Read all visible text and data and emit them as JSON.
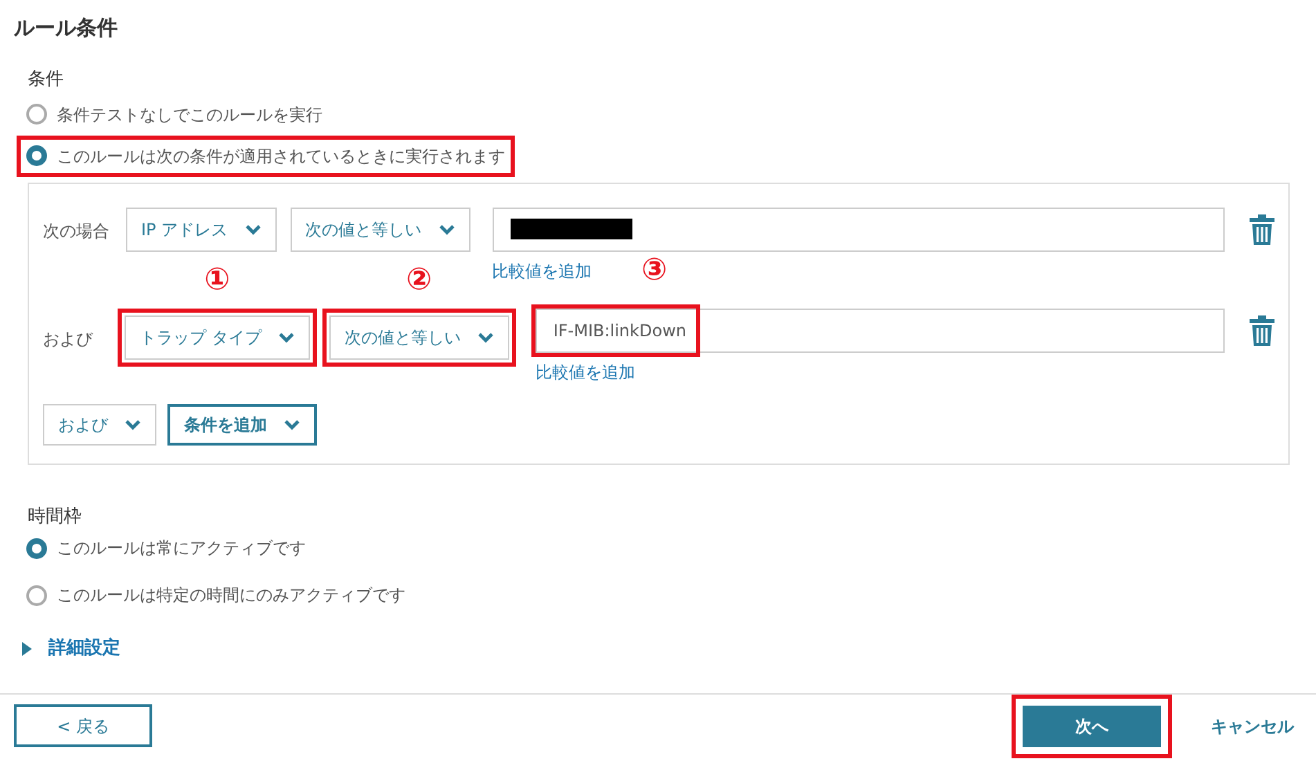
{
  "title": "ルール条件",
  "conditions": {
    "heading": "条件",
    "options": [
      {
        "label": "条件テストなしでこのルールを実行",
        "selected": false,
        "highlighted": false
      },
      {
        "label": "このルールは次の条件が適用されているときに実行されます",
        "selected": true,
        "highlighted": true
      }
    ],
    "rows": [
      {
        "connector": "次の場合",
        "field": {
          "label": "IP アドレス",
          "highlighted": false
        },
        "operator": {
          "label": "次の値と等しい",
          "highlighted": false
        },
        "value": {
          "redacted": true,
          "highlighted": false
        },
        "add_link": "比較値を追加"
      },
      {
        "connector": "および",
        "field": {
          "label": "トラップ タイプ",
          "highlighted": true,
          "callout": "①"
        },
        "operator": {
          "label": "次の値と等しい",
          "highlighted": true,
          "callout": "②"
        },
        "value": {
          "text": "IF-MIB:linkDown",
          "redacted": false,
          "highlighted": true,
          "callout": "③"
        },
        "add_link": "比較値を追加"
      }
    ],
    "join_select": "および",
    "add_condition": "条件を追加"
  },
  "timeframe": {
    "heading": "時間枠",
    "options": [
      {
        "label": "このルールは常にアクティブです",
        "selected": true
      },
      {
        "label": "このルールは特定の時間にのみアクティブです",
        "selected": false
      }
    ]
  },
  "advanced": {
    "label": "詳細設定",
    "expanded": false
  },
  "footer": {
    "back": "< 戻る",
    "next": {
      "label": "次へ",
      "highlighted": true
    },
    "cancel": "キャンセル"
  }
}
